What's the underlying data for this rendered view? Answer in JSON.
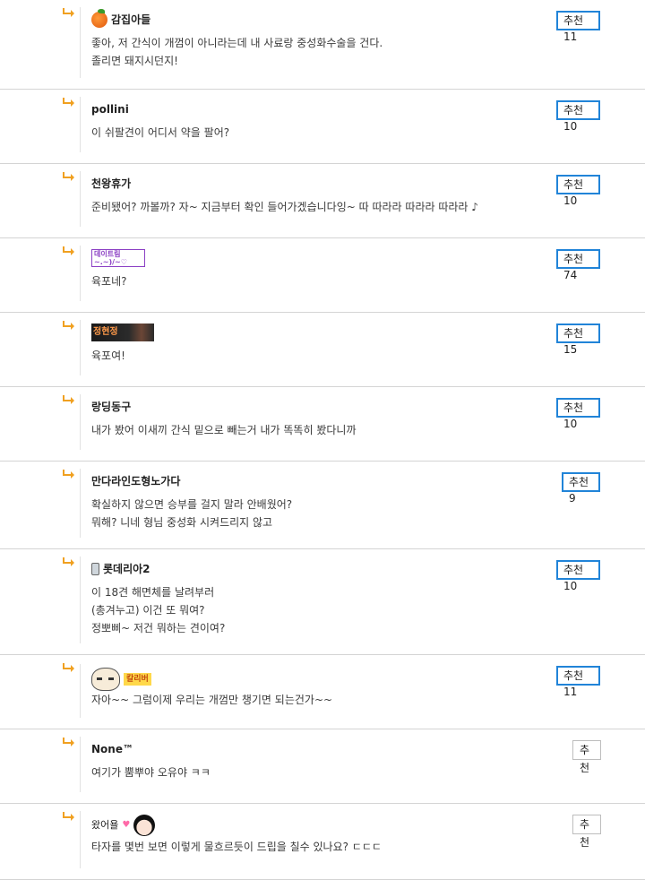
{
  "comments": [
    {
      "nick": "감집아들",
      "lines": [
        "좋아, 저 간식이 개껌이 아니라는데 내 사료랑 중성화수술을 건다.",
        "졸리면 돼지시던지!"
      ],
      "rec_label": "추천",
      "rec_count": "11",
      "icon": "tangerine-icon"
    },
    {
      "nick": "pollini",
      "lines": [
        "이 쉬팔견이 어디서 약을 팔어?"
      ],
      "rec_label": "추천",
      "rec_count": "10"
    },
    {
      "nick": "천왕휴가",
      "lines": [
        "준비됐어? 까볼까? 자~ 지금부터 확인 들어가겠습니다잉~ 따 따라라 따라라 따라라 ♪"
      ],
      "rec_label": "추천",
      "rec_count": "10"
    },
    {
      "nick": "",
      "badge_text": "데이트림 ~.~)/~♡",
      "lines": [
        "육포네?"
      ],
      "rec_label": "추천",
      "rec_count": "74"
    },
    {
      "nick": "",
      "badge_text": "정현정",
      "lines": [
        "육포여!"
      ],
      "rec_label": "추천",
      "rec_count": "15"
    },
    {
      "nick": "랑딩동구",
      "lines": [
        "내가 봤어 이새끼 간식 밑으로 빼는거 내가 똑똑히 봤다니까"
      ],
      "rec_label": "추천",
      "rec_count": "10"
    },
    {
      "nick": "만다라인도형노가다",
      "lines": [
        "확실하지 않으면 승부를 걸지 말라 안배웠어?",
        "뭐해? 니네 형님 중성화 시켜드리지 않고"
      ],
      "rec_label": "추천",
      "rec_count": "9"
    },
    {
      "nick": "롯데리아2",
      "lines": [
        "이 18견 해면체를 날려부러",
        "(총겨누고) 이건 또 뭐여?",
        "정뽀삐~ 저건 뭐하는 견이여?"
      ],
      "rec_label": "추천",
      "rec_count": "10",
      "icon": "phone-icon"
    },
    {
      "nick": "",
      "badge_text": "칼리버",
      "lines": [
        "자아~~ 그럼이제 우리는 개껌만 챙기면 되는건가~~"
      ],
      "rec_label": "추천",
      "rec_count": "11",
      "icon": "face-icon"
    },
    {
      "nick": "None™",
      "lines": [
        "여기가 뿜뿌야 오유야 ㅋㅋ"
      ],
      "rec_label": "추천",
      "rec_count": ""
    },
    {
      "nick": "",
      "badge_text": "왔어욜",
      "lines": [
        "타자를 몇번 보면 이렇게 물흐르듯이 드립을 칠수 있나요? ㄷㄷㄷ"
      ],
      "rec_label": "추천",
      "rec_count": "",
      "icon": "girl-icon"
    }
  ],
  "colors": {
    "accent": "#2184d8",
    "arrow": "#f0a020"
  }
}
